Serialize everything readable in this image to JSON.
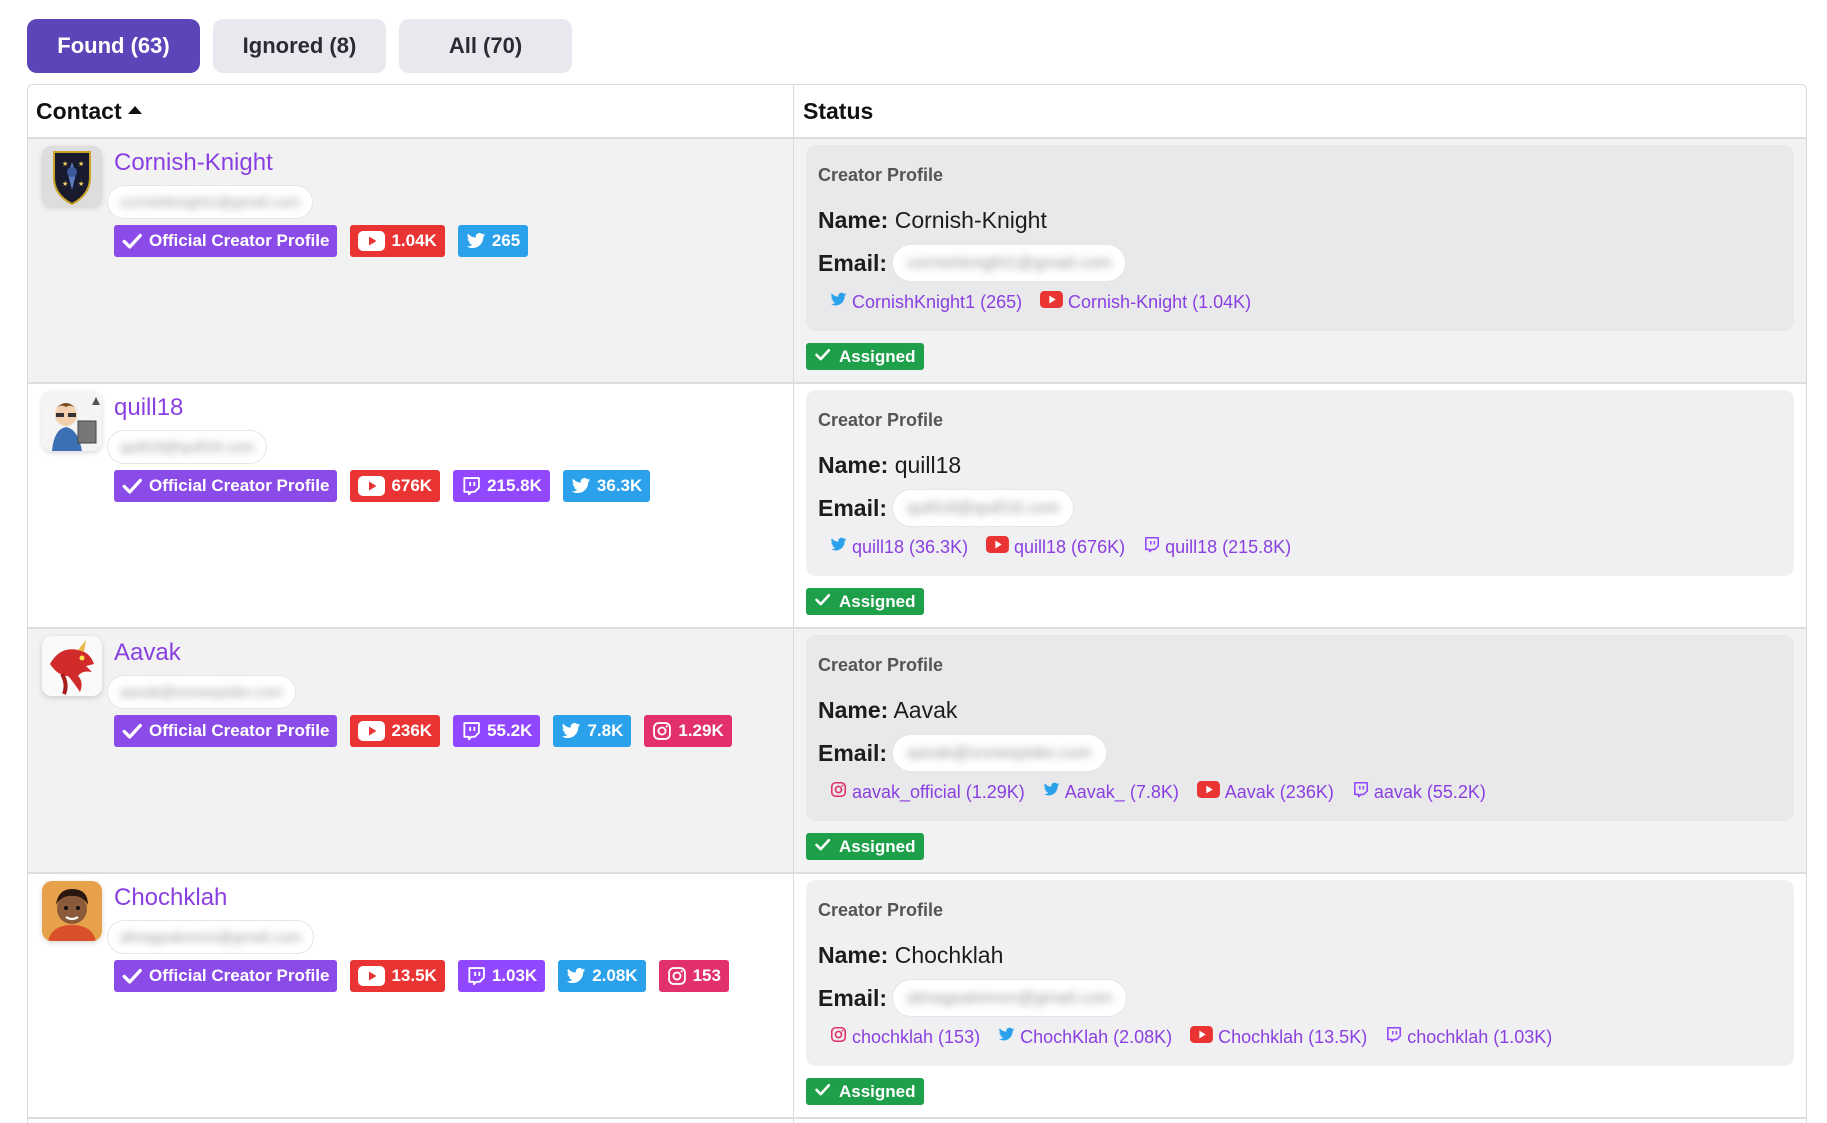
{
  "tabs": [
    {
      "label": "Found (63)",
      "active": true
    },
    {
      "label": "Ignored (8)",
      "active": false
    },
    {
      "label": "All (70)",
      "active": false
    }
  ],
  "table": {
    "col_contact": "Contact",
    "col_status": "Status"
  },
  "labels": {
    "official": "Official Creator Profile",
    "card_title": "Creator Profile",
    "name_label": "Name:",
    "email_label": "Email:",
    "assigned": "Assigned"
  },
  "colors": {
    "accent": "#5b45b8",
    "link_purple": "#8a3fe0",
    "youtube": "#ea3434",
    "twitter": "#2ba1eb",
    "twitch": "#9146ff",
    "instagram": "#e1306c",
    "assigned_green": "#1ea04a"
  },
  "rows": [
    {
      "name": "Cornish-Knight",
      "email": "cornishknight1@gmail.com",
      "badges": [
        {
          "platform": "youtube",
          "icon": "youtube-icon",
          "count": "1.04K"
        },
        {
          "platform": "twitter",
          "icon": "twitter-icon",
          "count": "265"
        }
      ],
      "links": [
        {
          "platform": "twitter",
          "icon": "twitter-icon",
          "text": "CornishKnight1 (265)"
        },
        {
          "platform": "youtube",
          "icon": "youtube-icon",
          "text": "Cornish-Knight (1.04K)"
        }
      ]
    },
    {
      "name": "quill18",
      "email": "quill18@quill18.com",
      "badges": [
        {
          "platform": "youtube",
          "icon": "youtube-icon",
          "count": "676K"
        },
        {
          "platform": "twitch",
          "icon": "twitch-icon",
          "count": "215.8K"
        },
        {
          "platform": "twitter",
          "icon": "twitter-icon",
          "count": "36.3K"
        }
      ],
      "links": [
        {
          "platform": "twitter",
          "icon": "twitter-icon",
          "text": "quill18 (36.3K)"
        },
        {
          "platform": "youtube",
          "icon": "youtube-icon",
          "text": "quill18 (676K)"
        },
        {
          "platform": "twitch",
          "icon": "twitch-icon",
          "text": "quill18 (215.8K)"
        }
      ]
    },
    {
      "name": "Aavak",
      "email": "aavak@snowspider.com",
      "badges": [
        {
          "platform": "youtube",
          "icon": "youtube-icon",
          "count": "236K"
        },
        {
          "platform": "twitch",
          "icon": "twitch-icon",
          "count": "55.2K"
        },
        {
          "platform": "twitter",
          "icon": "twitter-icon",
          "count": "7.8K"
        },
        {
          "platform": "instagram",
          "icon": "instagram-icon",
          "count": "1.29K"
        }
      ],
      "links": [
        {
          "platform": "instagram",
          "icon": "instagram-icon",
          "text": "aavak_official (1.29K)"
        },
        {
          "platform": "twitter",
          "icon": "twitter-icon",
          "text": "Aavak_ (7.8K)"
        },
        {
          "platform": "youtube",
          "icon": "youtube-icon",
          "text": "Aavak (236K)"
        },
        {
          "platform": "twitch",
          "icon": "twitch-icon",
          "text": "aavak (55.2K)"
        }
      ]
    },
    {
      "name": "Chochklah",
      "email": "almagsalomon@gmail.com",
      "badges": [
        {
          "platform": "youtube",
          "icon": "youtube-icon",
          "count": "13.5K"
        },
        {
          "platform": "twitch",
          "icon": "twitch-icon",
          "count": "1.03K"
        },
        {
          "platform": "twitter",
          "icon": "twitter-icon",
          "count": "2.08K"
        },
        {
          "platform": "instagram",
          "icon": "instagram-icon",
          "count": "153"
        }
      ],
      "links": [
        {
          "platform": "instagram",
          "icon": "instagram-icon",
          "text": "chochklah (153)"
        },
        {
          "platform": "twitter",
          "icon": "twitter-icon",
          "text": "ChochKlah (2.08K)"
        },
        {
          "platform": "youtube",
          "icon": "youtube-icon",
          "text": "Chochklah (13.5K)"
        },
        {
          "platform": "twitch",
          "icon": "twitch-icon",
          "text": "chochklah (1.03K)"
        }
      ]
    }
  ]
}
